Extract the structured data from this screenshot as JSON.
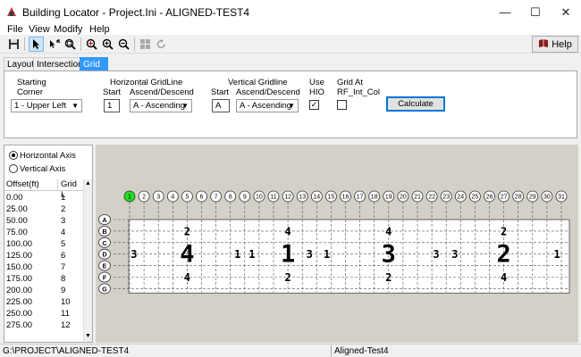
{
  "window": {
    "title": "Building Locator - Project.Ini - ALIGNED-TEST4"
  },
  "menu": {
    "items": [
      "File",
      "View",
      "Modify",
      "Help"
    ]
  },
  "toolbar": {
    "help_label": "Help"
  },
  "tabs": [
    {
      "label": "Layout",
      "selected": false
    },
    {
      "label": "Intersections",
      "selected": false
    },
    {
      "label": "Grid Lines",
      "selected": true
    }
  ],
  "grid_panel": {
    "starting_corner": {
      "label1": "Starting",
      "label2": "Corner",
      "value": "1 - Upper Left"
    },
    "horizontal": {
      "title": "Horizontal GridLine",
      "start_label": "Start",
      "start_value": "1",
      "order_label": "Ascend/Descend",
      "order_value": "A - Ascending"
    },
    "vertical": {
      "title": "Vertical Gridline",
      "start_label": "Start",
      "start_value": "A",
      "order_label": "Ascend/Descend",
      "order_value": "A - Ascending"
    },
    "use_hio": {
      "label1": "Use",
      "label2": "HIO",
      "checked": true
    },
    "grid_at": {
      "label1": "Grid At",
      "label2": "RF_Int_Col",
      "checked": false
    },
    "calculate_label": "Calculate"
  },
  "axis_options": {
    "horizontal_label": "Horizontal Axis",
    "vertical_label": "Vertical Axis",
    "selected": "horizontal"
  },
  "grid_table": {
    "headers": [
      "Offset(ft)",
      "Grid L"
    ],
    "rows": [
      [
        "0.00",
        "1"
      ],
      [
        "25.00",
        "2"
      ],
      [
        "50.00",
        "3"
      ],
      [
        "75.00",
        "4"
      ],
      [
        "100.00",
        "5"
      ],
      [
        "125.00",
        "6"
      ],
      [
        "150.00",
        "7"
      ],
      [
        "175.00",
        "8"
      ],
      [
        "200.00",
        "9"
      ],
      [
        "225.00",
        "10"
      ],
      [
        "250.00",
        "11"
      ],
      [
        "275.00",
        "12"
      ]
    ]
  },
  "drawing": {
    "column_labels": [
      "1",
      "2",
      "3",
      "4",
      "5",
      "6",
      "7",
      "8",
      "9",
      "10",
      "11",
      "12",
      "13",
      "14",
      "15",
      "16",
      "17",
      "18",
      "19",
      "20",
      "21",
      "22",
      "23",
      "24",
      "25",
      "26",
      "27",
      "28",
      "29",
      "30",
      "31"
    ],
    "highlighted_column": "1",
    "row_labels": [
      "A",
      "B",
      "C",
      "D",
      "E",
      "F",
      "G"
    ],
    "numbers": [
      {
        "text": "3",
        "col": 1.3,
        "row": "D",
        "size": "m"
      },
      {
        "text": "2",
        "col": 5,
        "row": "B",
        "size": "m"
      },
      {
        "text": "4",
        "col": 5,
        "row": "D",
        "size": "xl"
      },
      {
        "text": "4",
        "col": 5,
        "row": "F",
        "size": "m"
      },
      {
        "text": "1",
        "col": 8.5,
        "row": "D",
        "size": "m"
      },
      {
        "text": "1",
        "col": 9.5,
        "row": "D",
        "size": "m"
      },
      {
        "text": "4",
        "col": 12,
        "row": "B",
        "size": "m"
      },
      {
        "text": "1",
        "col": 12,
        "row": "D",
        "size": "xl"
      },
      {
        "text": "2",
        "col": 12,
        "row": "F",
        "size": "m"
      },
      {
        "text": "3",
        "col": 13.5,
        "row": "D",
        "size": "m"
      },
      {
        "text": "1",
        "col": 14.7,
        "row": "D",
        "size": "m"
      },
      {
        "text": "4",
        "col": 19,
        "row": "B",
        "size": "m"
      },
      {
        "text": "3",
        "col": 19,
        "row": "D",
        "size": "xl"
      },
      {
        "text": "2",
        "col": 19,
        "row": "F",
        "size": "m"
      },
      {
        "text": "3",
        "col": 22.3,
        "row": "D",
        "size": "m"
      },
      {
        "text": "3",
        "col": 23.6,
        "row": "D",
        "size": "m"
      },
      {
        "text": "2",
        "col": 27,
        "row": "B",
        "size": "m"
      },
      {
        "text": "2",
        "col": 27,
        "row": "D",
        "size": "xl"
      },
      {
        "text": "4",
        "col": 27,
        "row": "F",
        "size": "m"
      },
      {
        "text": "1",
        "col": 30.7,
        "row": "D",
        "size": "m"
      }
    ]
  },
  "statusbar": {
    "path": "G:\\PROJECT\\ALIGNED-TEST4",
    "name": "Aligned-Test4"
  }
}
